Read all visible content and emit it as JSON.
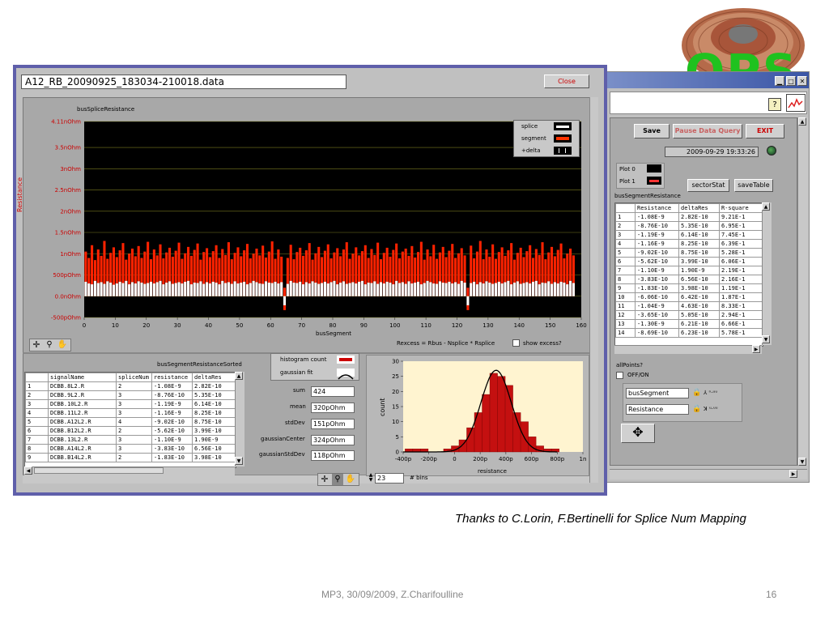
{
  "logo": {
    "text": "OPS"
  },
  "main_window": {
    "title": "A12_RB_20090925_183034-210018.data",
    "close_label": "Close",
    "chart_title": "busSpliceResistance",
    "legend": [
      {
        "name": "splice",
        "color": "#ffffff"
      },
      {
        "name": "segment",
        "color": "#ff2200"
      },
      {
        "name": "+delta",
        "color": "#ffffff"
      }
    ],
    "formula": "Rexcess = Rbus - Nsplice * Rsplice",
    "show_excess_label": "show excess?",
    "sorted_title": "busSegmentResistanceSorted",
    "sorted_headers": [
      "signalName",
      "spliceNum",
      "resistance",
      "deltaRes"
    ],
    "sorted_rows": [
      [
        "1",
        "DCBB.8L2.R",
        "2",
        "-1.08E-9",
        "2.82E-10"
      ],
      [
        "2",
        "DCBB.9L2.R",
        "3",
        "-8.76E-10",
        "5.35E-10"
      ],
      [
        "3",
        "DCBB.10L2.R",
        "3",
        "-1.19E-9",
        "6.14E-10"
      ],
      [
        "4",
        "DCBB.11L2.R",
        "3",
        "-1.16E-9",
        "8.25E-10"
      ],
      [
        "5",
        "DCBB.A12L2.R",
        "4",
        "-9.02E-10",
        "8.75E-10"
      ],
      [
        "6",
        "DCBB.B12L2.R",
        "2",
        "-5.62E-10",
        "3.99E-10"
      ],
      [
        "7",
        "DCBB.13L2.R",
        "3",
        "-1.10E-9",
        "1.90E-9"
      ],
      [
        "8",
        "DCBB.A14L2.R",
        "3",
        "-3.83E-10",
        "6.56E-10"
      ],
      [
        "9",
        "DCBB.B14L2.R",
        "2",
        "-1.83E-10",
        "3.98E-10"
      ]
    ],
    "hist_legend": [
      {
        "name": "histogram count"
      },
      {
        "name": "gaussian fit"
      }
    ],
    "stats": [
      {
        "label": "sum",
        "value": "424"
      },
      {
        "label": "mean",
        "value": "320pOhm"
      },
      {
        "label": "stdDev",
        "value": "151pOhm"
      },
      {
        "label": "gaussianCenter",
        "value": "324pOhm"
      },
      {
        "label": "gaussianStdDev",
        "value": "118pOhm"
      }
    ],
    "bins_value": "23",
    "bins_label": "# bins"
  },
  "second_window": {
    "save_label": "Save",
    "pause_label": "Pause Data Query",
    "exit_label": "EXIT",
    "datetime": "2009-09-29 19:33:26",
    "plot0_label": "Plot 0",
    "plot1_label": "Plot 1",
    "sector_stat_label": "sectorStat",
    "save_table_label": "saveTable",
    "table_title": "busSegmentResistance",
    "headers": [
      "Resistance",
      "deltaRes",
      "R-square"
    ],
    "rows": [
      [
        "1",
        "-1.08E-9",
        "2.82E-10",
        "9.21E-1"
      ],
      [
        "2",
        "-8.76E-10",
        "5.35E-10",
        "6.95E-1"
      ],
      [
        "3",
        "-1.19E-9",
        "6.14E-10",
        "7.45E-1"
      ],
      [
        "4",
        "-1.16E-9",
        "8.25E-10",
        "6.39E-1"
      ],
      [
        "5",
        "-9.02E-10",
        "8.75E-10",
        "5.28E-1"
      ],
      [
        "6",
        "-5.62E-10",
        "3.99E-10",
        "6.06E-1"
      ],
      [
        "7",
        "-1.10E-9",
        "1.90E-9",
        "2.19E-1"
      ],
      [
        "8",
        "-3.83E-10",
        "6.56E-10",
        "2.16E-1"
      ],
      [
        "9",
        "-1.83E-10",
        "3.98E-10",
        "1.19E-1"
      ],
      [
        "10",
        "-6.06E-10",
        "6.42E-10",
        "1.87E-1"
      ],
      [
        "11",
        "-1.04E-9",
        "4.63E-10",
        "8.33E-1"
      ],
      [
        "12",
        "-3.65E-10",
        "5.05E-10",
        "2.94E-1"
      ],
      [
        "13",
        "-1.30E-9",
        "6.21E-10",
        "6.66E-1"
      ],
      [
        "14",
        "-8.69E-10",
        "6.23E-10",
        "5.78E-1"
      ]
    ],
    "all_points_label": "allPoints?",
    "off_on_label": "OFF/ON",
    "x_axis_select": "busSegment",
    "y_axis_select": "Resistance"
  },
  "footer": {
    "credit": "Thanks to C.Lorin, F.Bertinelli for Splice Num Mapping",
    "author": "MP3, 30/09/2009, Z.Charifoulline",
    "page": "16"
  },
  "chart_data": [
    {
      "type": "bar",
      "title": "busSpliceResistance",
      "xlabel": "busSegment",
      "ylabel": "Resistance",
      "xlim": [
        0,
        160
      ],
      "ylim": [
        -0.5,
        4.11
      ],
      "x_ticks": [
        "0",
        "10",
        "20",
        "30",
        "40",
        "50",
        "60",
        "70",
        "80",
        "90",
        "100",
        "110",
        "120",
        "130",
        "140",
        "150",
        "160"
      ],
      "y_ticks": [
        "4.11nOhm",
        "3.5nOhm",
        "3nOhm",
        "2.5nOhm",
        "2nOhm",
        "1.5nOhm",
        "1nOhm",
        "500pOhm",
        "0.0nOhm",
        "-500pOhm"
      ],
      "series": [
        {
          "name": "splice",
          "color": "#ffffff",
          "values": [
            0.34,
            0.3,
            0.28,
            0.36,
            0.31,
            0.33,
            0.29,
            0.35,
            0.32,
            0.27,
            0.3,
            0.34,
            0.31,
            0.36,
            0.28,
            0.33,
            0.3,
            0.35,
            0.32,
            0.29,
            0.31,
            0.34,
            0.3,
            0.33,
            0.36,
            0.28,
            0.32,
            0.35,
            0.29,
            0.31,
            0.33,
            0.3,
            0.34,
            0.36,
            0.28,
            0.32,
            0.31,
            0.35,
            0.29,
            0.33,
            0.3,
            0.34,
            0.32,
            0.28,
            0.36,
            0.31,
            0.33,
            0.29,
            0.35,
            0.3,
            0.32,
            0.34,
            0.28,
            0.31,
            0.36,
            0.33,
            0.3,
            0.29,
            0.35,
            0.32,
            0.31,
            0.34,
            0.3,
            0.33,
            -0.25,
            0.29,
            0.36,
            0.32,
            0.31,
            0.34,
            0.28,
            0.33,
            0.3,
            0.35,
            0.32,
            0.29,
            0.31,
            0.34,
            0.3,
            0.33,
            0.36,
            0.28,
            0.32,
            0.35,
            0.29,
            0.31,
            0.33,
            0.3,
            0.34,
            0.36,
            0.28,
            0.32,
            0.31,
            0.35,
            0.29,
            0.33,
            0.3,
            0.34,
            0.32,
            0.28,
            0.36,
            0.31,
            0.33,
            0.29,
            0.35,
            0.3,
            0.32,
            0.34,
            0.28,
            0.31,
            0.36,
            0.33,
            0.3,
            0.29,
            0.35,
            0.32,
            0.31,
            0.34,
            0.3,
            0.33,
            0.29,
            0.36,
            0.32,
            -0.25,
            0.31,
            0.34,
            0.28,
            0.33,
            0.3,
            0.35,
            0.32,
            0.29,
            0.31,
            0.34,
            0.3,
            0.33,
            0.36,
            0.28,
            0.32,
            0.35,
            0.29,
            0.31,
            0.33,
            0.3,
            0.34,
            0.36,
            0.28,
            0.32,
            0.31,
            0.35,
            0.29,
            0.33,
            0.3,
            0.34,
            0.32,
            0.28,
            0.36,
            0.31
          ]
        },
        {
          "name": "segment",
          "color": "#ff2200",
          "values": [
            1.05,
            0.9,
            1.2,
            0.85,
            1.1,
            0.95,
            1.3,
            0.88,
            1.02,
            1.15,
            0.92,
            1.08,
            1.25,
            0.86,
            1.0,
            1.12,
            0.94,
            1.18,
            0.9,
            1.05,
            1.28,
            0.87,
            1.1,
            0.96,
            1.22,
            0.89,
            1.03,
            1.14,
            0.93,
            1.07,
            1.26,
            0.88,
            1.01,
            1.16,
            0.95,
            1.09,
            1.24,
            0.86,
            1.04,
            1.13,
            0.92,
            1.06,
            1.2,
            0.9,
            1.11,
            0.97,
            1.27,
            0.87,
            1.02,
            1.15,
            0.94,
            1.08,
            1.23,
            0.89,
            1.0,
            1.12,
            0.96,
            1.19,
            0.91,
            1.05,
            1.29,
            0.88,
            1.1,
            0.93,
            0.2,
            0.9,
            1.21,
            0.87,
            1.04,
            1.14,
            0.95,
            1.08,
            1.25,
            0.86,
            1.01,
            1.16,
            0.92,
            1.07,
            1.22,
            0.89,
            1.03,
            1.13,
            0.94,
            1.1,
            1.27,
            0.88,
            1.0,
            1.15,
            0.96,
            1.06,
            1.2,
            0.9,
            1.11,
            0.97,
            1.26,
            0.87,
            1.02,
            1.14,
            0.93,
            1.09,
            1.24,
            0.89,
            1.05,
            1.12,
            0.95,
            1.18,
            0.91,
            1.04,
            1.28,
            0.86,
            1.1,
            0.94,
            1.21,
            0.88,
            1.03,
            1.16,
            0.92,
            1.07,
            1.23,
            0.9,
            1.01,
            1.13,
            0.96,
            0.2,
            1.19,
            0.89,
            1.05,
            1.3,
            0.87,
            1.1,
            0.93,
            1.22,
            0.88,
            1.04,
            1.15,
            0.95,
            1.08,
            1.25,
            0.86,
            1.02,
            1.14,
            0.92,
            1.06,
            1.2,
            0.9,
            1.11,
            0.97,
            1.27,
            0.87,
            1.03,
            1.16,
            0.94,
            1.09,
            1.24,
            0.89,
            1.0,
            1.12,
            0.96
          ]
        }
      ]
    },
    {
      "type": "bar",
      "title": "",
      "xlabel": "resistance",
      "ylabel": "count",
      "xlim": [
        -400,
        1000
      ],
      "ylim": [
        0,
        30
      ],
      "x_ticks": [
        "-400p",
        "-200p",
        "0",
        "200p",
        "400p",
        "600p",
        "800p",
        "1n"
      ],
      "y_ticks": [
        "0",
        "5",
        "10",
        "15",
        "20",
        "25",
        "30"
      ],
      "bins_center": [
        -355,
        -295,
        -235,
        -175,
        -115,
        -55,
        5,
        65,
        125,
        185,
        245,
        305,
        365,
        425,
        485,
        545,
        605,
        665,
        725,
        785
      ],
      "counts": [
        1,
        1,
        1,
        0,
        0,
        1,
        2,
        4,
        8,
        13,
        19,
        26,
        25,
        22,
        13,
        10,
        5,
        2,
        1,
        1
      ],
      "gaussian_center": 324,
      "gaussian_std": 118,
      "gaussian_peak": 27
    }
  ]
}
